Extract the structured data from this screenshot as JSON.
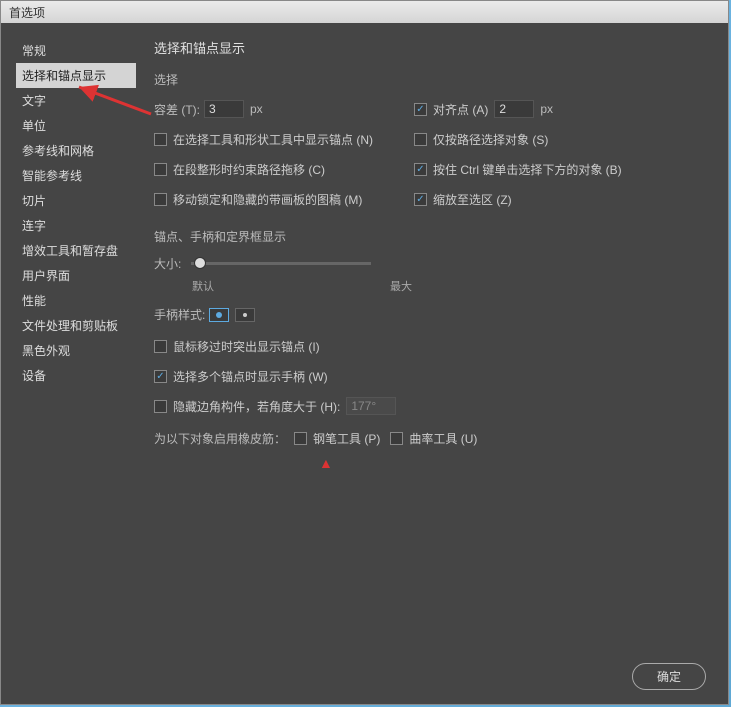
{
  "window": {
    "title": "首选项"
  },
  "sidebar": {
    "items": [
      {
        "label": "常规"
      },
      {
        "label": "选择和锚点显示"
      },
      {
        "label": "文字"
      },
      {
        "label": "单位"
      },
      {
        "label": "参考线和网格"
      },
      {
        "label": "智能参考线"
      },
      {
        "label": "切片"
      },
      {
        "label": "连字"
      },
      {
        "label": "增效工具和暂存盘"
      },
      {
        "label": "用户界面"
      },
      {
        "label": "性能"
      },
      {
        "label": "文件处理和剪贴板"
      },
      {
        "label": "黑色外观"
      },
      {
        "label": "设备"
      }
    ],
    "selected_index": 1
  },
  "main": {
    "title": "选择和锚点显示",
    "selection": {
      "heading": "选择",
      "tolerance_label": "容差 (T):",
      "tolerance_value": "3",
      "tolerance_unit": "px",
      "snap_label": "对齐点 (A)",
      "snap_value": "2",
      "snap_unit": "px",
      "show_anchor": "在选择工具和形状工具中显示锚点 (N)",
      "path_only": "仅按路径选择对象 (S)",
      "constrain": "在段整形时约束路径拖移 (C)",
      "ctrl_click": "按住 Ctrl 键单击选择下方的对象 (B)",
      "move_locked": "移动锁定和隐藏的带画板的图稿 (M)",
      "zoom_sel": "缩放至选区 (Z)"
    },
    "anchors": {
      "heading": "锚点、手柄和定界框显示",
      "size_label": "大小:",
      "size_min": "默认",
      "size_max": "最大",
      "handle_style_label": "手柄样式:",
      "highlight_hover": "鼠标移过时突出显示锚点 (I)",
      "show_handles_multi": "选择多个锚点时显示手柄 (W)",
      "hide_corner": "隐藏边角构件，若角度大于 (H):",
      "angle_value": "177°",
      "rubber_band_label": "为以下对象启用橡皮筋：",
      "pen_tool": "钢笔工具 (P)",
      "curve_tool": "曲率工具 (U)"
    }
  },
  "buttons": {
    "ok": "确定"
  }
}
